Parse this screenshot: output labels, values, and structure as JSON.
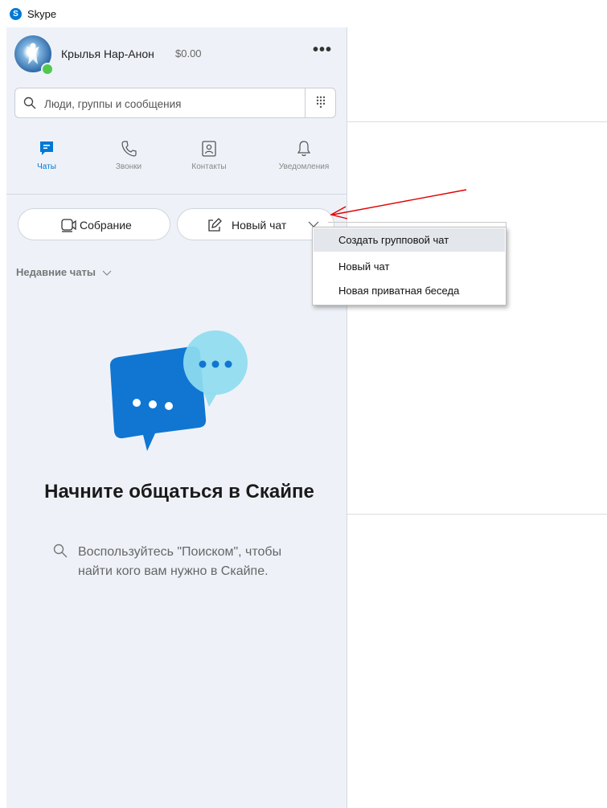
{
  "window": {
    "title": "Skype",
    "logo_letter": "S"
  },
  "profile": {
    "name": "Крылья Нар-Анон",
    "balance": "$0.00",
    "more": "•••",
    "status": "online"
  },
  "search": {
    "placeholder": "Люди, группы и сообщения",
    "value": ""
  },
  "nav": {
    "tabs": [
      {
        "label": "Чаты",
        "icon": "chat-icon",
        "active": true
      },
      {
        "label": "Звонки",
        "icon": "phone-icon",
        "active": false
      },
      {
        "label": "Контакты",
        "icon": "contacts-icon",
        "active": false
      },
      {
        "label": "Уведомления",
        "icon": "bell-icon",
        "active": false
      }
    ]
  },
  "actions": {
    "meeting_label": "Собрание",
    "new_chat_label": "Новый чат"
  },
  "recent": {
    "label": "Недавние чаты"
  },
  "empty_state": {
    "title": "Начните общаться в Скайпе",
    "description": "Воспользуйтесь \"Поиском\", чтобы найти кого вам нужно в Скайпе."
  },
  "dropdown_menu": {
    "items": [
      {
        "label": "Создать групповой чат",
        "highlighted": true
      },
      {
        "label": "Новый чат",
        "highlighted": false
      },
      {
        "label": "Новая приватная беседа",
        "highlighted": false
      }
    ]
  },
  "colors": {
    "accent": "#0078d4",
    "sidebar_bg": "#eef2f8",
    "presence": "#50c84d",
    "arrow": "#e00000"
  }
}
